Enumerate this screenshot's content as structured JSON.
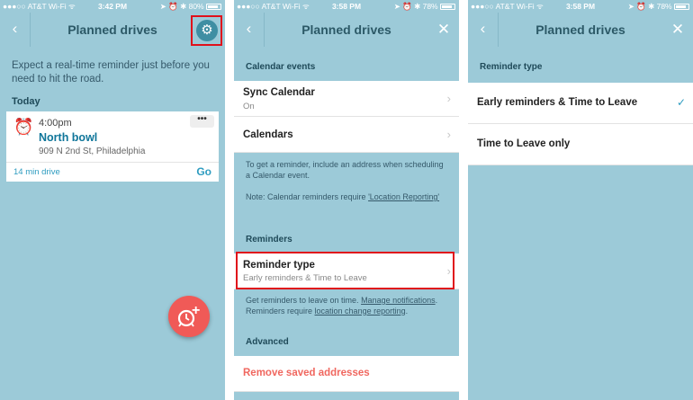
{
  "status": {
    "s1": {
      "carrier": "●●●○○ AT&T Wi-Fi ᯤ",
      "time": "3:42 PM",
      "right": "➤ ⏰ ✱ 80%"
    },
    "s2": {
      "carrier": "●●●○○ AT&T Wi-Fi ᯤ",
      "time": "3:58 PM",
      "right": "➤ ⏰ ✱ 78%"
    },
    "s3": {
      "carrier": "●●●○○ AT&T Wi-Fi ᯤ",
      "time": "3:58 PM",
      "right": "➤ ⏰ ✱ 78%"
    }
  },
  "icons": {
    "back": "‹",
    "close": "✕",
    "settings": "⚙",
    "clock": "⏰",
    "more": "•••",
    "chevron": "›",
    "check": "✓",
    "plus": "+"
  },
  "colors": {
    "background": "#9ccad8",
    "title": "#2c5967",
    "accent": "#2e9cc0",
    "danger": "#f0675f",
    "highlight": "#e0111b"
  },
  "screen1": {
    "title": "Planned drives",
    "intro": "Expect a real-time reminder just before you need to hit the road.",
    "section": "Today",
    "drive": {
      "time": "4:00pm",
      "name": "North bowl",
      "address": "909 N 2nd St, Philadelphia",
      "duration": "14 min drive",
      "action": "Go"
    }
  },
  "screen2": {
    "title": "Planned drives",
    "calendar_header": "Calendar events",
    "sync": {
      "title": "Sync Calendar",
      "value": "On"
    },
    "calendars": {
      "title": "Calendars"
    },
    "calendar_note1": "To get a reminder, include an address when scheduling a Calendar event.",
    "calendar_note2_prefix": "Note: Calendar reminders require ",
    "calendar_note2_link": "'Location Reporting'",
    "reminders_header": "Reminders",
    "reminder_type": {
      "title": "Reminder type",
      "value": "Early reminders & Time to Leave"
    },
    "reminders_note1_prefix": "Get reminders to leave on time. ",
    "reminders_note1_link": "Manage notifications",
    "reminders_note1_suffix": ".",
    "reminders_note2_prefix": "Reminders require ",
    "reminders_note2_link": "location change reporting",
    "reminders_note2_suffix": ".",
    "advanced_header": "Advanced",
    "remove_addresses": "Remove saved addresses"
  },
  "screen3": {
    "title": "Planned drives",
    "header": "Reminder type",
    "options": [
      {
        "label": "Early reminders & Time to Leave",
        "selected": true
      },
      {
        "label": "Time to Leave only",
        "selected": false
      }
    ]
  }
}
